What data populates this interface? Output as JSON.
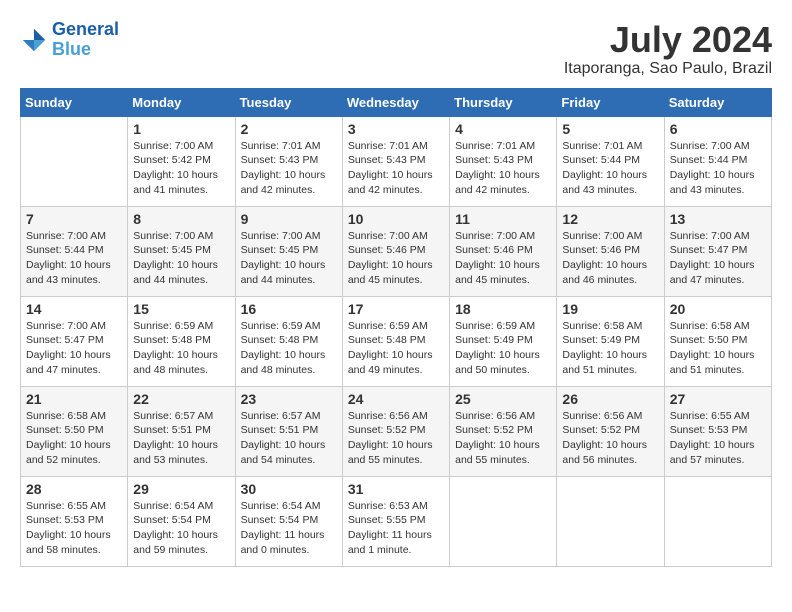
{
  "header": {
    "logo_line1": "General",
    "logo_line2": "Blue",
    "month": "July 2024",
    "location": "Itaporanga, Sao Paulo, Brazil"
  },
  "weekdays": [
    "Sunday",
    "Monday",
    "Tuesday",
    "Wednesday",
    "Thursday",
    "Friday",
    "Saturday"
  ],
  "weeks": [
    [
      null,
      {
        "day": 1,
        "sunrise": "7:00 AM",
        "sunset": "5:42 PM",
        "daylight": "10 hours and 41 minutes."
      },
      {
        "day": 2,
        "sunrise": "7:01 AM",
        "sunset": "5:43 PM",
        "daylight": "10 hours and 42 minutes."
      },
      {
        "day": 3,
        "sunrise": "7:01 AM",
        "sunset": "5:43 PM",
        "daylight": "10 hours and 42 minutes."
      },
      {
        "day": 4,
        "sunrise": "7:01 AM",
        "sunset": "5:43 PM",
        "daylight": "10 hours and 42 minutes."
      },
      {
        "day": 5,
        "sunrise": "7:01 AM",
        "sunset": "5:44 PM",
        "daylight": "10 hours and 43 minutes."
      },
      {
        "day": 6,
        "sunrise": "7:00 AM",
        "sunset": "5:44 PM",
        "daylight": "10 hours and 43 minutes."
      }
    ],
    [
      {
        "day": 7,
        "sunrise": "7:00 AM",
        "sunset": "5:44 PM",
        "daylight": "10 hours and 43 minutes."
      },
      {
        "day": 8,
        "sunrise": "7:00 AM",
        "sunset": "5:45 PM",
        "daylight": "10 hours and 44 minutes."
      },
      {
        "day": 9,
        "sunrise": "7:00 AM",
        "sunset": "5:45 PM",
        "daylight": "10 hours and 44 minutes."
      },
      {
        "day": 10,
        "sunrise": "7:00 AM",
        "sunset": "5:46 PM",
        "daylight": "10 hours and 45 minutes."
      },
      {
        "day": 11,
        "sunrise": "7:00 AM",
        "sunset": "5:46 PM",
        "daylight": "10 hours and 45 minutes."
      },
      {
        "day": 12,
        "sunrise": "7:00 AM",
        "sunset": "5:46 PM",
        "daylight": "10 hours and 46 minutes."
      },
      {
        "day": 13,
        "sunrise": "7:00 AM",
        "sunset": "5:47 PM",
        "daylight": "10 hours and 47 minutes."
      }
    ],
    [
      {
        "day": 14,
        "sunrise": "7:00 AM",
        "sunset": "5:47 PM",
        "daylight": "10 hours and 47 minutes."
      },
      {
        "day": 15,
        "sunrise": "6:59 AM",
        "sunset": "5:48 PM",
        "daylight": "10 hours and 48 minutes."
      },
      {
        "day": 16,
        "sunrise": "6:59 AM",
        "sunset": "5:48 PM",
        "daylight": "10 hours and 48 minutes."
      },
      {
        "day": 17,
        "sunrise": "6:59 AM",
        "sunset": "5:48 PM",
        "daylight": "10 hours and 49 minutes."
      },
      {
        "day": 18,
        "sunrise": "6:59 AM",
        "sunset": "5:49 PM",
        "daylight": "10 hours and 50 minutes."
      },
      {
        "day": 19,
        "sunrise": "6:58 AM",
        "sunset": "5:49 PM",
        "daylight": "10 hours and 51 minutes."
      },
      {
        "day": 20,
        "sunrise": "6:58 AM",
        "sunset": "5:50 PM",
        "daylight": "10 hours and 51 minutes."
      }
    ],
    [
      {
        "day": 21,
        "sunrise": "6:58 AM",
        "sunset": "5:50 PM",
        "daylight": "10 hours and 52 minutes."
      },
      {
        "day": 22,
        "sunrise": "6:57 AM",
        "sunset": "5:51 PM",
        "daylight": "10 hours and 53 minutes."
      },
      {
        "day": 23,
        "sunrise": "6:57 AM",
        "sunset": "5:51 PM",
        "daylight": "10 hours and 54 minutes."
      },
      {
        "day": 24,
        "sunrise": "6:56 AM",
        "sunset": "5:52 PM",
        "daylight": "10 hours and 55 minutes."
      },
      {
        "day": 25,
        "sunrise": "6:56 AM",
        "sunset": "5:52 PM",
        "daylight": "10 hours and 55 minutes."
      },
      {
        "day": 26,
        "sunrise": "6:56 AM",
        "sunset": "5:52 PM",
        "daylight": "10 hours and 56 minutes."
      },
      {
        "day": 27,
        "sunrise": "6:55 AM",
        "sunset": "5:53 PM",
        "daylight": "10 hours and 57 minutes."
      }
    ],
    [
      {
        "day": 28,
        "sunrise": "6:55 AM",
        "sunset": "5:53 PM",
        "daylight": "10 hours and 58 minutes."
      },
      {
        "day": 29,
        "sunrise": "6:54 AM",
        "sunset": "5:54 PM",
        "daylight": "10 hours and 59 minutes."
      },
      {
        "day": 30,
        "sunrise": "6:54 AM",
        "sunset": "5:54 PM",
        "daylight": "11 hours and 0 minutes."
      },
      {
        "day": 31,
        "sunrise": "6:53 AM",
        "sunset": "5:55 PM",
        "daylight": "11 hours and 1 minute."
      },
      null,
      null,
      null
    ]
  ]
}
